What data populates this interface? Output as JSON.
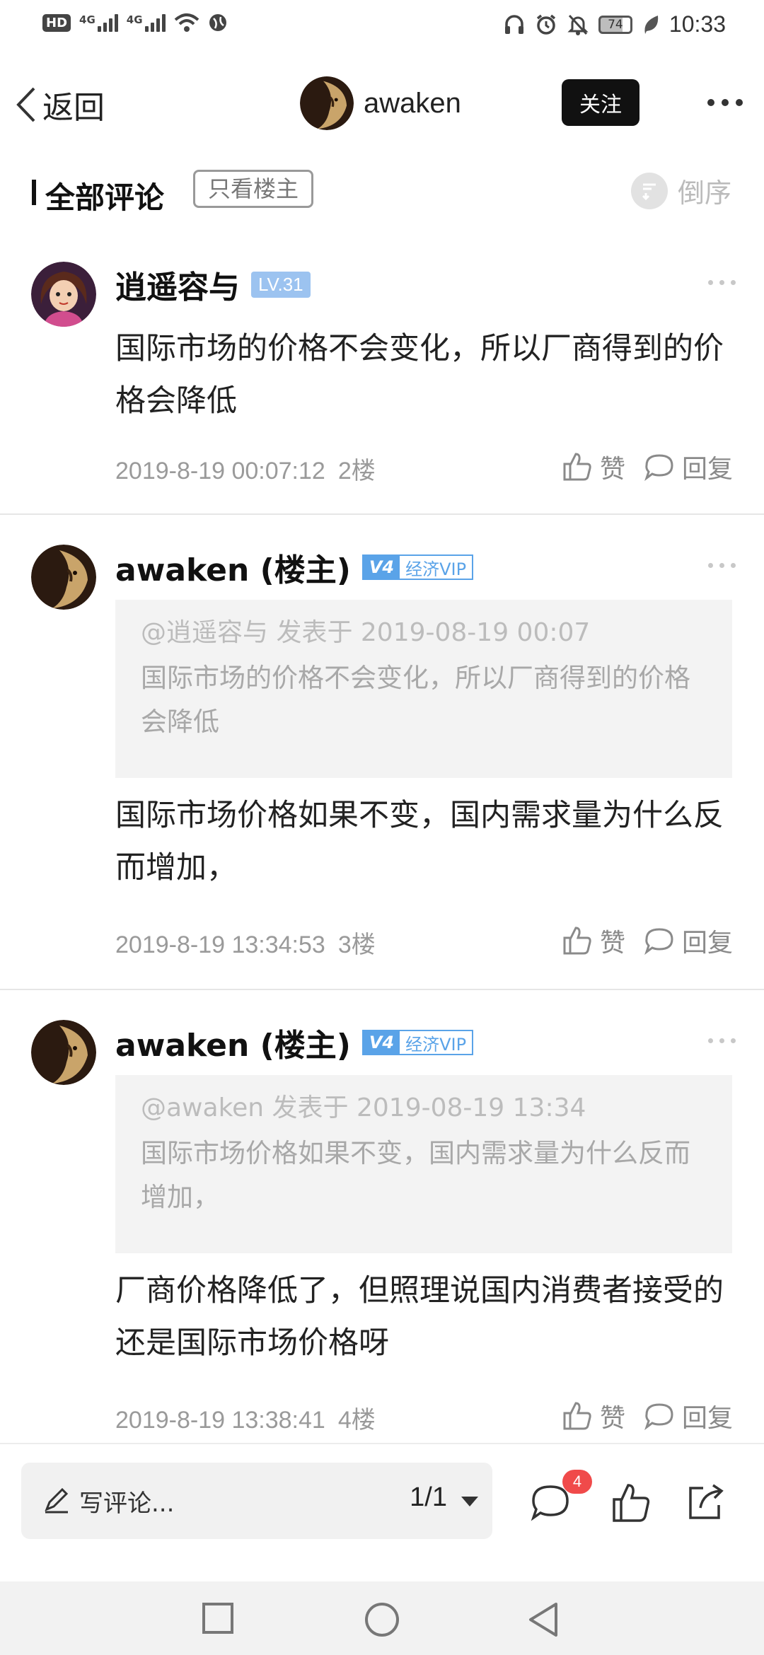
{
  "status_bar": {
    "hd": "HD",
    "net1": "4G",
    "net2": "4G",
    "battery": "74",
    "time": "10:33"
  },
  "header": {
    "back_label": "返回",
    "username": "awaken",
    "follow_label": "关注"
  },
  "filter": {
    "title": "全部评论",
    "only_op": "只看楼主",
    "sort": "倒序"
  },
  "comments": [
    {
      "name": "逍遥容与",
      "level": "LV.31",
      "text": "国际市场的价格不会变化，所以厂商得到的价格会降低",
      "time": "2019-8-19 00:07:12",
      "floor": "2楼",
      "like": "赞",
      "reply": "回复"
    },
    {
      "name": "awaken (楼主)",
      "vip_v": "V4",
      "vip_label": "经济VIP",
      "quote_meta": "@逍遥容与 发表于 2019-08-19 00:07",
      "quote_text": "国际市场的价格不会变化，所以厂商得到的价格会降低",
      "text": "国际市场价格如果不变，国内需求量为什么反而增加，",
      "time": "2019-8-19 13:34:53",
      "floor": "3楼",
      "like": "赞",
      "reply": "回复"
    },
    {
      "name": "awaken (楼主)",
      "vip_v": "V4",
      "vip_label": "经济VIP",
      "quote_meta": "@awaken 发表于 2019-08-19 13:34",
      "quote_text": "国际市场价格如果不变，国内需求量为什么反而增加，",
      "text": "厂商价格降低了，但照理说国内消费者接受的还是国际市场价格呀",
      "time": "2019-8-19 13:38:41",
      "floor": "4楼",
      "like": "赞",
      "reply": "回复"
    }
  ],
  "bottom_bar": {
    "write_placeholder": "写评论...",
    "page": "1/1",
    "comment_count": "4"
  },
  "colors": {
    "level_badge": "#9cc3f0",
    "vip": "#5aa3e8",
    "badge_red": "#f04a4a",
    "follow_bg": "#111111"
  },
  "icons": [
    "back-chevron-icon",
    "more-icon",
    "sort-icon",
    "like-icon",
    "reply-icon",
    "pen-icon",
    "comment-icon",
    "thumb-up-icon",
    "share-icon",
    "nav-square-icon",
    "nav-circle-icon",
    "nav-back-icon"
  ]
}
